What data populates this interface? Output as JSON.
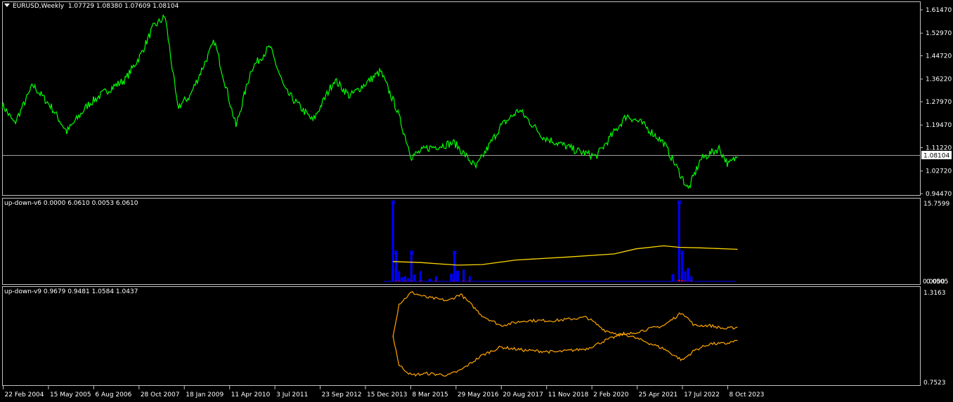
{
  "main": {
    "title": "EURUSD,Weekly",
    "ohlc": "1.07729 1.08380 1.07609 1.08104",
    "price_ticks": [
      "1.61470",
      "1.52970",
      "1.44720",
      "1.36220",
      "1.27970",
      "1.19470",
      "1.11220",
      "1.02720",
      "0.94470"
    ],
    "current_price": "1.08104"
  },
  "ind1": {
    "title": "up-down-v6 0.0000 6.0610 0.0053 6.0610",
    "ticks": [
      "15.7599",
      "0.0000"
    ],
    "overlap_tick": "0.0505"
  },
  "ind2": {
    "title": "up-down-v9 0.9679 0.9481 1.0584 1.0437",
    "ticks": [
      "1.3163",
      "0.7523"
    ]
  },
  "time_axis": [
    "22 Feb 2004",
    "15 May 2005",
    "6 Aug 2006",
    "28 Oct 2007",
    "18 Jan 2009",
    "11 Apr 2010",
    "3 Jul 2011",
    "23 Sep 2012",
    "15 Dec 2013",
    "8 Mar 2015",
    "29 May 2016",
    "20 Aug 2017",
    "11 Nov 2018",
    "2 Feb 2020",
    "25 Apr 2021",
    "17 Jul 2022",
    "8 Oct 2023"
  ],
  "colors": {
    "price": "#00ff00",
    "up_histogram": "#0000ff",
    "down_histogram": "#ff0000",
    "ma_line": "#ffd700",
    "osc_line": "#ffa500",
    "grid": "#c0c0c0",
    "bg": "#000000"
  },
  "chart_data": [
    {
      "type": "line",
      "title": "EURUSD,Weekly",
      "x": [
        "2004-02",
        "2004-06",
        "2004-12",
        "2005-06",
        "2005-11",
        "2006-06",
        "2006-12",
        "2007-06",
        "2007-11",
        "2008-03",
        "2008-07",
        "2008-11",
        "2009-03",
        "2009-11",
        "2010-06",
        "2010-11",
        "2011-05",
        "2011-10",
        "2012-07",
        "2013-02",
        "2013-07",
        "2014-05",
        "2014-10",
        "2015-03",
        "2015-08",
        "2016-05",
        "2016-12",
        "2017-08",
        "2018-02",
        "2018-10",
        "2019-09",
        "2020-03",
        "2021-01",
        "2021-06",
        "2022-01",
        "2022-09",
        "2023-01",
        "2023-07",
        "2023-10",
        "2024-01"
      ],
      "y": [
        1.27,
        1.2,
        1.34,
        1.26,
        1.17,
        1.27,
        1.32,
        1.36,
        1.45,
        1.55,
        1.59,
        1.26,
        1.3,
        1.5,
        1.19,
        1.4,
        1.48,
        1.32,
        1.21,
        1.36,
        1.3,
        1.39,
        1.26,
        1.08,
        1.11,
        1.13,
        1.04,
        1.19,
        1.25,
        1.15,
        1.1,
        1.08,
        1.23,
        1.2,
        1.13,
        0.96,
        1.07,
        1.11,
        1.05,
        1.08
      ],
      "ylim": [
        0.9447,
        1.6147
      ]
    },
    {
      "type": "bar",
      "title": "up-down-v6 0.0000 6.0610 0.0053 6.0610",
      "x": [
        "2014-09",
        "2014-10",
        "2014-11",
        "2015-01",
        "2015-03",
        "2015-06",
        "2015-11",
        "2016-05",
        "2016-08",
        "2016-10",
        "2022-06",
        "2022-07",
        "2022-08",
        "2022-10"
      ],
      "series": [
        {
          "values": [
            15.7,
            5.8,
            2.0,
            1.0,
            5.8,
            2.0,
            1.0,
            5.8,
            2.3,
            1.0,
            15.7,
            5.8,
            2.0,
            1.0
          ]
        },
        {
          "values": [
            0.2,
            0.1,
            0.1,
            0.1,
            0.1,
            0.1,
            0.1,
            0.1,
            0.1,
            0.1,
            0.3,
            0.2,
            0.1,
            0.1
          ]
        }
      ],
      "line_series": {
        "x": [
          "2014-09",
          "2015-06",
          "2016-06",
          "2017-02",
          "2018-01",
          "2019-06",
          "2020-09",
          "2021-04",
          "2022-01",
          "2022-06",
          "2023-01",
          "2024-01"
        ],
        "y": [
          3.9,
          3.7,
          3.2,
          3.3,
          4.2,
          4.8,
          5.4,
          6.4,
          7.0,
          6.7,
          6.6,
          6.3
        ]
      },
      "ylim": [
        0.0,
        15.7599
      ]
    },
    {
      "type": "line",
      "title": "up-down-v9 0.9679 0.9481 1.0584 1.0437",
      "x": [
        "2014-09",
        "2014-11",
        "2015-03",
        "2015-08",
        "2016-03",
        "2016-07",
        "2017-02",
        "2017-08",
        "2018-04",
        "2019-02",
        "2019-12",
        "2020-06",
        "2020-12",
        "2021-06",
        "2022-01",
        "2022-07",
        "2022-11",
        "2023-04",
        "2023-09",
        "2024-01"
      ],
      "series": [
        {
          "values": [
            1.04,
            1.23,
            1.3,
            1.27,
            1.25,
            1.29,
            1.16,
            1.1,
            1.13,
            1.13,
            1.15,
            1.07,
            1.04,
            1.07,
            1.1,
            1.18,
            1.1,
            1.1,
            1.08,
            1.09
          ]
        },
        {
          "values": [
            1.04,
            0.86,
            0.8,
            0.81,
            0.8,
            0.83,
            0.92,
            0.97,
            0.95,
            0.94,
            0.96,
            1.01,
            1.05,
            1.01,
            0.96,
            0.89,
            0.95,
            0.99,
            0.99,
            1.01
          ]
        }
      ],
      "ylim": [
        0.7523,
        1.3163
      ]
    }
  ]
}
